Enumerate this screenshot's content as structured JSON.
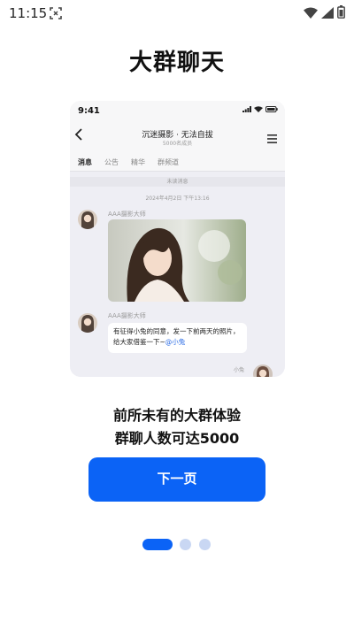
{
  "status_bar": {
    "time": "11:15",
    "icons": [
      "screenshot-icon",
      "wifi-icon",
      "signal-icon",
      "battery-icon"
    ]
  },
  "title": "大群聊天",
  "preview": {
    "time": "9:41",
    "chat_title": "沉迷摄影 · 无法自拔",
    "member_count": "5000名成员",
    "tabs": [
      "消息",
      "公告",
      "精华",
      "群频道"
    ],
    "active_tab": "消息",
    "unread_label": "未读消息",
    "date": "2024年4月2日 下午13:16",
    "messages": [
      {
        "sender": "AAA摄影大师",
        "type": "image"
      },
      {
        "sender": "AAA摄影大师",
        "type": "text",
        "text": "有征得小兔的同意，发一下前两天的照片，给大家借鉴一下~",
        "mention": "@小兔"
      }
    ],
    "self_name": "小兔"
  },
  "description": {
    "line1": "前所未有的大群体验",
    "line2": "群聊人数可达5000"
  },
  "next_button": "下一页",
  "pager": {
    "count": 3,
    "current": 1
  },
  "colors": {
    "accent": "#0b63f6",
    "dot_inactive": "#c9d7f3"
  }
}
